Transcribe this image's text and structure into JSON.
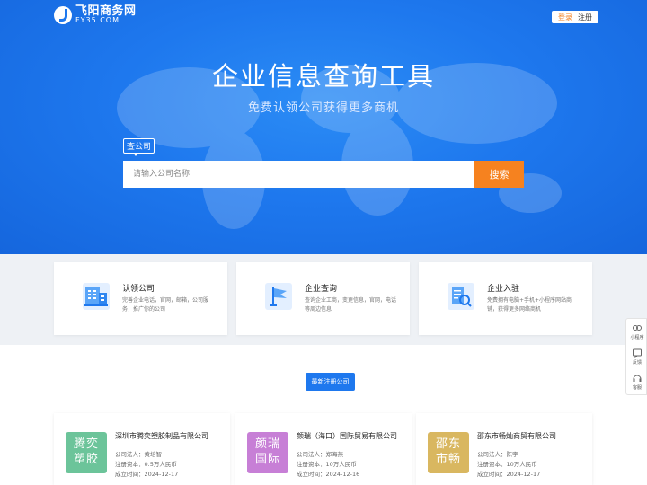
{
  "header": {
    "logo_cn": "飞阳商务网",
    "logo_en": "FY35.COM",
    "login": "登录",
    "register": "注册"
  },
  "hero": {
    "title": "企业信息查询工具",
    "subtitle": "免费认领公司获得更多商机",
    "search_tag": "查公司",
    "search_placeholder": "请输入公司名称",
    "search_button": "搜索"
  },
  "features": [
    {
      "title": "认领公司",
      "desc": "完善企业电话，官网，邮箱，公司服务，推广你的公司",
      "icon": "building-icon"
    },
    {
      "title": "企业查询",
      "desc": "查询企业工商，变更信息，官网，电话等周边信息",
      "icon": "flag-icon"
    },
    {
      "title": "企业入驻",
      "desc": "免费拥有电脑+手机+小程序网站商铺，获得更多网络商机",
      "icon": "document-search-icon"
    }
  ],
  "latest": {
    "button": "最新注册公司",
    "companies": [
      {
        "avatar": "腾奕塑胶",
        "avatar_color": "#6cc49a",
        "name": "深圳市腾奕塑胶制品有限公司",
        "legal": "公司法人：黄培智",
        "capital": "注册资本：0.5万人民币",
        "date": "成立时间：2024-12-17"
      },
      {
        "avatar": "颜瑞国际",
        "avatar_color": "#c77fd6",
        "name": "颜瑞（海口）国际贸易有限公司",
        "legal": "公司法人：郑海燕",
        "capital": "注册资本：10万人民币",
        "date": "成立时间：2024-12-16"
      },
      {
        "avatar": "邵东市畅",
        "avatar_color": "#d9b760",
        "name": "邵东市畅灿商贸有限公司",
        "legal": "公司法人：陈宇",
        "capital": "注册资本：10万人民币",
        "date": "成立时间：2024-12-17"
      }
    ]
  },
  "side": {
    "miniapp": "小程序",
    "feedback": "反馈",
    "service": "客服"
  },
  "colors": {
    "primary": "#1e78ee",
    "accent": "#f6821f"
  }
}
